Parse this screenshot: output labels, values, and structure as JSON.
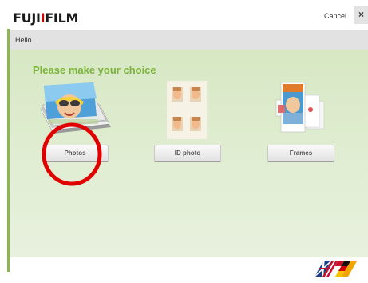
{
  "header": {
    "brand_prefix": "FUJI",
    "brand_accent": "I",
    "brand_suffix": "FILM",
    "cancel_label": "Cancel",
    "close_label": "×"
  },
  "greeting": "Hello.",
  "main": {
    "heading": "Please make your choice",
    "choices": [
      {
        "label": "Photos"
      },
      {
        "label": "ID photo"
      },
      {
        "label": "Frames"
      }
    ]
  },
  "colors": {
    "accent_green": "#7ab23a",
    "panel_green": "#d7e8c4",
    "annotation_red": "#e00000",
    "brand_red": "#d40000"
  }
}
